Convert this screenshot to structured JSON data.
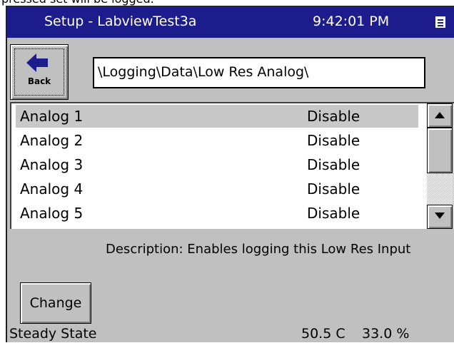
{
  "caption_text": "pressed set will be logged.",
  "titlebar": {
    "title": "Setup - LabviewTest3a",
    "clock": "9:42:01 PM",
    "menu_icon": "menu-icon"
  },
  "toolbar": {
    "back_label": "Back",
    "back_icon": "left-arrow-icon",
    "path": "\\Logging\\Data\\Low Res Analog\\"
  },
  "list": {
    "items": [
      {
        "name": "Analog 1",
        "value": "Disable",
        "selected": true
      },
      {
        "name": "Analog 2",
        "value": "Disable",
        "selected": false
      },
      {
        "name": "Analog 3",
        "value": "Disable",
        "selected": false
      },
      {
        "name": "Analog 4",
        "value": "Disable",
        "selected": false
      },
      {
        "name": "Analog 5",
        "value": "Disable",
        "selected": false
      }
    ]
  },
  "description": "Description:  Enables logging this Low Res Input",
  "change_label": "Change",
  "status": {
    "state": "Steady State",
    "temperature": "50.5 C",
    "percent": "33.0 %"
  },
  "colors": {
    "titlebar": "#1c1c8c",
    "window": "#c0c0c0",
    "selection": "#c8c8c8"
  }
}
